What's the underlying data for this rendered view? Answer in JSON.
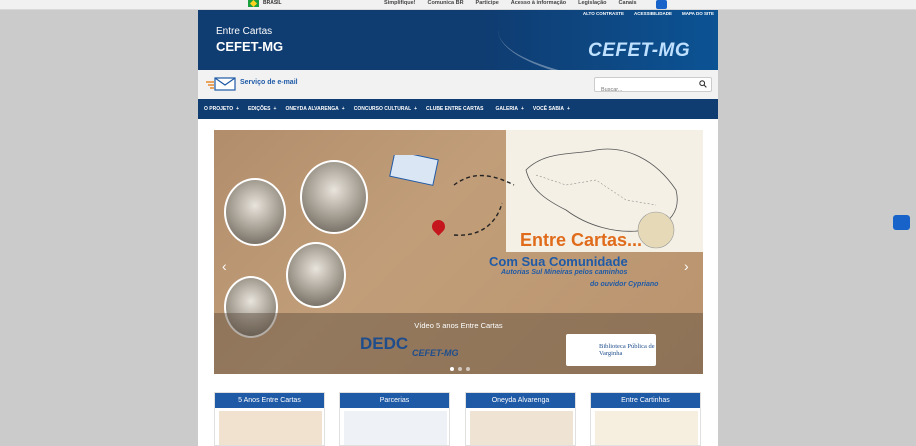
{
  "gov_bar": {
    "brasil": "BRASIL",
    "links": [
      "Simplifique!",
      "Comunica BR",
      "Participe",
      "Acesso à informação",
      "Legislação",
      "Canais"
    ]
  },
  "accessibility": [
    "ALTO CONTRASTE",
    "ACESSIBILIDADE",
    "MAPA DO SITE"
  ],
  "header": {
    "title_line1": "Entre Cartas",
    "title_line2": "CEFET-MG",
    "logo": "CEFET-MG"
  },
  "service_bar": {
    "email_label": "Serviço de e-mail",
    "search_placeholder": "Buscar..."
  },
  "nav": [
    {
      "label": "O PROJETO",
      "arrow": "+"
    },
    {
      "label": "EDIÇÕES",
      "arrow": "+"
    },
    {
      "label": "ONEYDA ALVARENGA",
      "arrow": "+"
    },
    {
      "label": "CONCURSO CULTURAL",
      "arrow": "+"
    },
    {
      "label": "CLUBE ENTRE CARTAS",
      "arrow": ""
    },
    {
      "label": "GALERIA",
      "arrow": "+"
    },
    {
      "label": "VOCÊ SABIA",
      "arrow": "+"
    }
  ],
  "banner": {
    "title": "Entre Cartas...",
    "subtitle": "Com Sua Comunidade",
    "line1": "Autorias Sul Mineiras pelos caminhos",
    "line2": "do ouvidor Cypriano",
    "caption": "Vídeo 5 anos Entre Cartas",
    "dedc": "DEDC",
    "cefet": "CEFET-MG",
    "biblioteca": "Biblioteca Pública de Varginha",
    "prev": "‹",
    "next": "›"
  },
  "cards": [
    "5 Anos Entre Cartas",
    "Parcerias",
    "Oneyda Alvarenga",
    "Entre Cartinhas"
  ],
  "colors": {
    "primary": "#0f3c71",
    "accent": "#1f5aa6",
    "orange": "#e06b1b"
  }
}
